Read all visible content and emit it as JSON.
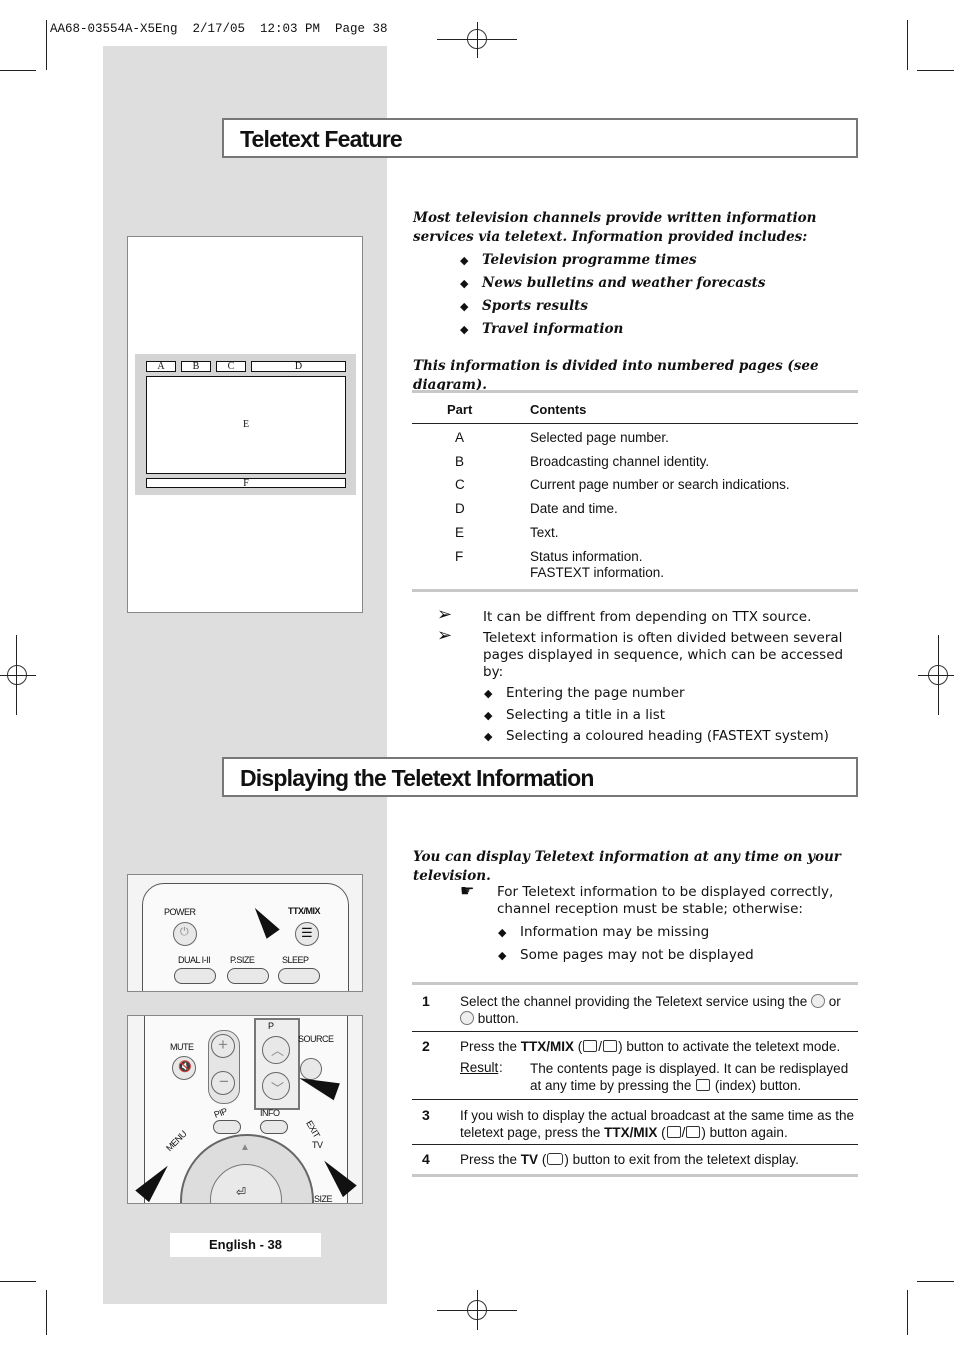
{
  "slug": "AA68-03554A-X5Eng  2/17/05  12:03 PM  Page 38",
  "section1": {
    "title": "Teletext Feature",
    "intro": "Most television channels provide written information services via teletext. Information provided includes:",
    "bullets": [
      "Television programme times",
      "News bulletins and weather forecasts",
      "Sports results",
      "Travel information"
    ],
    "divided_note": "This information is divided into numbered pages (see diagram).",
    "diagram": {
      "labels": [
        "A",
        "B",
        "C",
        "D",
        "E",
        "F"
      ]
    },
    "table": {
      "headers": [
        "Part",
        "Contents"
      ],
      "rows": [
        {
          "part": "A",
          "contents": "Selected page number."
        },
        {
          "part": "B",
          "contents": "Broadcasting channel identity."
        },
        {
          "part": "C",
          "contents": "Current page number or search indications."
        },
        {
          "part": "D",
          "contents": "Date and time."
        },
        {
          "part": "E",
          "contents": "Text."
        },
        {
          "part": "F",
          "contents": "Status information.",
          "contents2": "FASTEXT information."
        }
      ]
    },
    "notes": [
      "It can be  diffrent from depending on TTX source.",
      "Teletext information is often divided between several pages displayed in sequence, which can be accessed by:"
    ],
    "note_bullets": [
      "Entering the page number",
      "Selecting a title in a list",
      "Selecting a coloured heading (FASTEXT system)"
    ]
  },
  "section2": {
    "title": "Displaying the Teletext Information",
    "intro": "You can display Teletext information at any time on your television.",
    "caution": "For Teletext information to be displayed correctly, channel reception must be stable; otherwise:",
    "caution_bullets": [
      "Information may be missing",
      "Some pages may not be displayed"
    ],
    "steps": [
      {
        "num": "1",
        "a": "Select the channel providing the Teletext service using the",
        "b": "or",
        "c": "button."
      },
      {
        "num": "2",
        "a": "Press the",
        "bold": "TTX/MIX",
        "b": "button to activate the teletext mode.",
        "result_label": "Result",
        "result": "The contents page is displayed. It can be redisplayed at any time by pressing the",
        "result_end": "(index) button."
      },
      {
        "num": "3",
        "a": "If you wish to display the actual broadcast at the same time as the teletext page, press the",
        "bold": "TTX/MIX",
        "b": "button again."
      },
      {
        "num": "4",
        "a": "Press the",
        "bold": "TV",
        "b": "button to exit from the teletext display."
      }
    ],
    "remote1": {
      "power": "POWER",
      "ttx": "TTX/MIX",
      "dual": "DUAL I-II",
      "psize": "P.SIZE",
      "sleep": "SLEEP"
    },
    "remote2": {
      "mute": "MUTE",
      "p": "P",
      "source": "SOURCE",
      "pip": "PIP",
      "info": "INFO",
      "menu": "MENU",
      "exit": "EXIT",
      "tv": "TV",
      "size": "SIZE"
    }
  },
  "footer": "English - 38"
}
